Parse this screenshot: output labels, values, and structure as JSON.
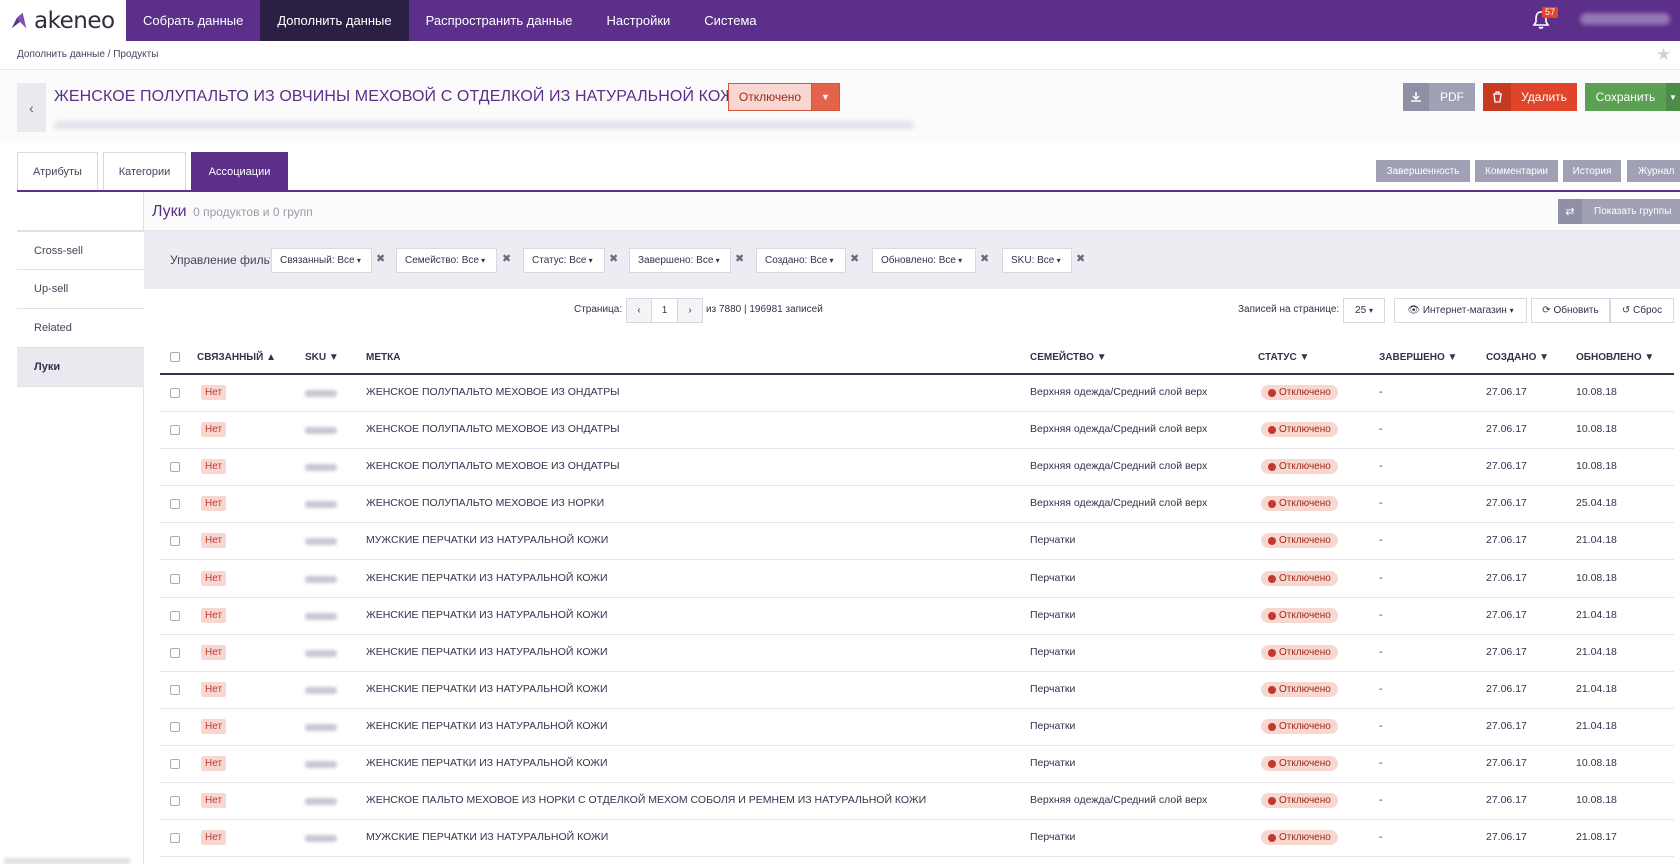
{
  "app": {
    "logo_text": "akeneo"
  },
  "nav": [
    {
      "label": "Собрать данные",
      "active": false
    },
    {
      "label": "Дополнить данные",
      "active": true
    },
    {
      "label": "Распространить данные",
      "active": false
    },
    {
      "label": "Настройки",
      "active": false
    },
    {
      "label": "Система",
      "active": false
    }
  ],
  "notifications": {
    "count": "57"
  },
  "breadcrumb": "Дополнить данные / Продукты",
  "product": {
    "title": "ЖЕНСКОЕ ПОЛУПАЛЬТО ИЗ ОВЧИНЫ МЕХОВОЙ С ОТДЕЛКОЙ ИЗ НАТУРАЛЬНОЙ КОЖИ",
    "status": "Отключено"
  },
  "actions": {
    "pdf": "PDF",
    "delete": "Удалить",
    "save": "Сохранить"
  },
  "tabs": {
    "attributes": "Атрибуты",
    "categories": "Категории",
    "associations": "Ассоциации"
  },
  "panels": {
    "completeness": "Завершенность",
    "comments": "Комментарии",
    "history": "История",
    "log": "Журнал"
  },
  "association_types": [
    "Cross-sell",
    "Up-sell",
    "Related",
    "Луки"
  ],
  "association": {
    "title": "Луки",
    "count": "0 продуктов и 0 групп",
    "show_groups": "Показать группы"
  },
  "filters": {
    "label": "Управление фильтрами",
    "chips": [
      {
        "name": "Связанный",
        "value": "Все"
      },
      {
        "name": "Семейство",
        "value": "Все"
      },
      {
        "name": "Статус",
        "value": "Все"
      },
      {
        "name": "Завершено",
        "value": "Все"
      },
      {
        "name": "Создано",
        "value": "Все"
      },
      {
        "name": "Обновлено",
        "value": "Все"
      },
      {
        "name": "SKU",
        "value": "Все"
      }
    ]
  },
  "pagination": {
    "page_label": "Страница:",
    "page": "1",
    "of_text": "из 7880 | 196981 записей",
    "per_page_label": "Записей на странице:",
    "per_page": "25",
    "channel": "Интернет-магазин",
    "refresh": "Обновить",
    "reset": "Сброс"
  },
  "table": {
    "columns": [
      "СВЯЗАННЫЙ",
      "SKU",
      "МЕТКА",
      "СЕМЕЙСТВО",
      "СТАТУС",
      "ЗАВЕРШЕНО",
      "СОЗДАНО",
      "ОБНОВЛЕНО"
    ],
    "rows": [
      {
        "linked": "Нет",
        "label": "ЖЕНСКОЕ ПОЛУПАЛЬТО МЕХОВОЕ ИЗ ОНДАТРЫ",
        "family": "Верхняя одежда/Средний слой верх",
        "status": "Отключено",
        "complete": "-",
        "created": "27.06.17",
        "updated": "10.08.18"
      },
      {
        "linked": "Нет",
        "label": "ЖЕНСКОЕ ПОЛУПАЛЬТО МЕХОВОЕ ИЗ ОНДАТРЫ",
        "family": "Верхняя одежда/Средний слой верх",
        "status": "Отключено",
        "complete": "-",
        "created": "27.06.17",
        "updated": "10.08.18"
      },
      {
        "linked": "Нет",
        "label": "ЖЕНСКОЕ ПОЛУПАЛЬТО МЕХОВОЕ ИЗ ОНДАТРЫ",
        "family": "Верхняя одежда/Средний слой верх",
        "status": "Отключено",
        "complete": "-",
        "created": "27.06.17",
        "updated": "10.08.18"
      },
      {
        "linked": "Нет",
        "label": "ЖЕНСКОЕ ПОЛУПАЛЬТО МЕХОВОЕ ИЗ НОРКИ",
        "family": "Верхняя одежда/Средний слой верх",
        "status": "Отключено",
        "complete": "-",
        "created": "27.06.17",
        "updated": "25.04.18"
      },
      {
        "linked": "Нет",
        "label": "МУЖСКИЕ ПЕРЧАТКИ ИЗ НАТУРАЛЬНОЙ КОЖИ",
        "family": "Перчатки",
        "status": "Отключено",
        "complete": "-",
        "created": "27.06.17",
        "updated": "21.04.18"
      },
      {
        "linked": "Нет",
        "label": "ЖЕНСКИЕ ПЕРЧАТКИ ИЗ НАТУРАЛЬНОЙ КОЖИ",
        "family": "Перчатки",
        "status": "Отключено",
        "complete": "-",
        "created": "27.06.17",
        "updated": "10.08.18"
      },
      {
        "linked": "Нет",
        "label": "ЖЕНСКИЕ ПЕРЧАТКИ ИЗ НАТУРАЛЬНОЙ КОЖИ",
        "family": "Перчатки",
        "status": "Отключено",
        "complete": "-",
        "created": "27.06.17",
        "updated": "21.04.18"
      },
      {
        "linked": "Нет",
        "label": "ЖЕНСКИЕ ПЕРЧАТКИ ИЗ НАТУРАЛЬНОЙ КОЖИ",
        "family": "Перчатки",
        "status": "Отключено",
        "complete": "-",
        "created": "27.06.17",
        "updated": "21.04.18"
      },
      {
        "linked": "Нет",
        "label": "ЖЕНСКИЕ ПЕРЧАТКИ ИЗ НАТУРАЛЬНОЙ КОЖИ",
        "family": "Перчатки",
        "status": "Отключено",
        "complete": "-",
        "created": "27.06.17",
        "updated": "21.04.18"
      },
      {
        "linked": "Нет",
        "label": "ЖЕНСКИЕ ПЕРЧАТКИ ИЗ НАТУРАЛЬНОЙ КОЖИ",
        "family": "Перчатки",
        "status": "Отключено",
        "complete": "-",
        "created": "27.06.17",
        "updated": "21.04.18"
      },
      {
        "linked": "Нет",
        "label": "ЖЕНСКИЕ ПЕРЧАТКИ ИЗ НАТУРАЛЬНОЙ КОЖИ",
        "family": "Перчатки",
        "status": "Отключено",
        "complete": "-",
        "created": "27.06.17",
        "updated": "10.08.18"
      },
      {
        "linked": "Нет",
        "label": "ЖЕНСКОЕ ПАЛЬТО МЕХОВОЕ ИЗ НОРКИ С ОТДЕЛКОЙ МЕХОМ СОБОЛЯ И РЕМНЕМ ИЗ НАТУРАЛЬНОЙ КОЖИ",
        "family": "Верхняя одежда/Средний слой верх",
        "status": "Отключено",
        "complete": "-",
        "created": "27.06.17",
        "updated": "10.08.18"
      },
      {
        "linked": "Нет",
        "label": "МУЖСКИЕ ПЕРЧАТКИ ИЗ НАТУРАЛЬНОЙ КОЖИ",
        "family": "Перчатки",
        "status": "Отключено",
        "complete": "-",
        "created": "27.06.17",
        "updated": "21.08.17"
      }
    ]
  },
  "icons": {
    "logo": "akeneo-logo-icon",
    "bell": "bell-icon",
    "star": "star-icon",
    "back": "chevron-left-icon",
    "download": "download-icon",
    "trash": "trash-icon",
    "shuffle": "shuffle-icon",
    "close": "close-icon",
    "eye": "eye-icon",
    "refresh": "refresh-icon",
    "reset": "reset-icon"
  },
  "colors": {
    "brand": "#5b2f8a",
    "danger": "#e0442a",
    "success": "#5ba053",
    "neutral": "#a1a1b5"
  }
}
